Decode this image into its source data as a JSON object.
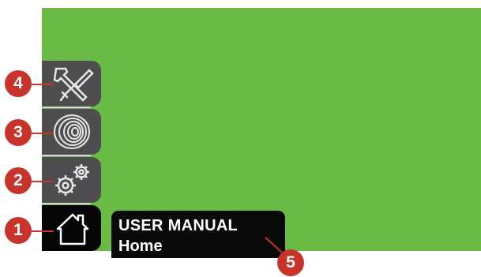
{
  "status_box": {
    "title": "USER MANUAL",
    "subtitle": "Home"
  },
  "tabs": [
    {
      "id": "tools",
      "icon": "wrench-screwdriver-icon"
    },
    {
      "id": "spool",
      "icon": "wire-spool-icon"
    },
    {
      "id": "settings",
      "icon": "gears-icon"
    },
    {
      "id": "home",
      "icon": "home-icon"
    }
  ],
  "callouts": {
    "home": "1",
    "settings": "2",
    "spool": "3",
    "tools": "4",
    "status": "5"
  },
  "colors": {
    "screen": "#6abb45",
    "tab": "#4e4e50",
    "tab_active": "#050505",
    "callout": "#c8332b"
  }
}
